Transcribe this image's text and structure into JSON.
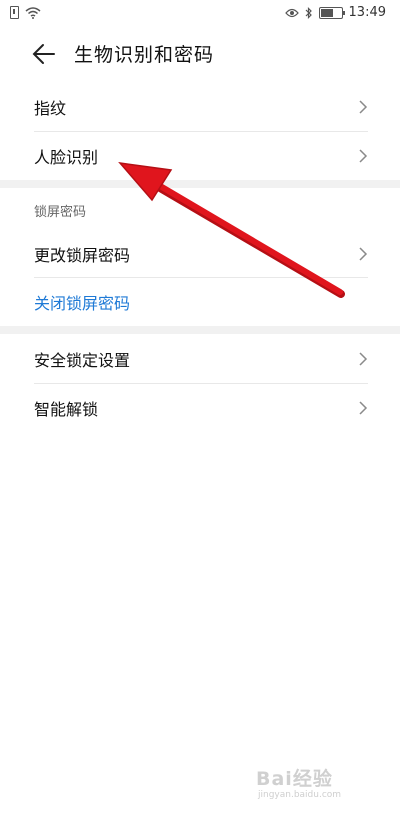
{
  "status": {
    "time": "13:49"
  },
  "header": {
    "title": "生物识别和密码"
  },
  "list": {
    "fingerprint": "指纹",
    "face": "人脸识别",
    "lock_section": "锁屏密码",
    "change_lock": "更改锁屏密码",
    "disable_lock": "关闭锁屏密码",
    "security_lock_settings": "安全锁定设置",
    "smart_unlock": "智能解锁"
  },
  "colors": {
    "accent_blue": "#1f7ad6",
    "annotation_red": "#e0151d"
  },
  "watermark": {
    "brand": "Bai经验",
    "url": "jingyan.baidu.com"
  }
}
